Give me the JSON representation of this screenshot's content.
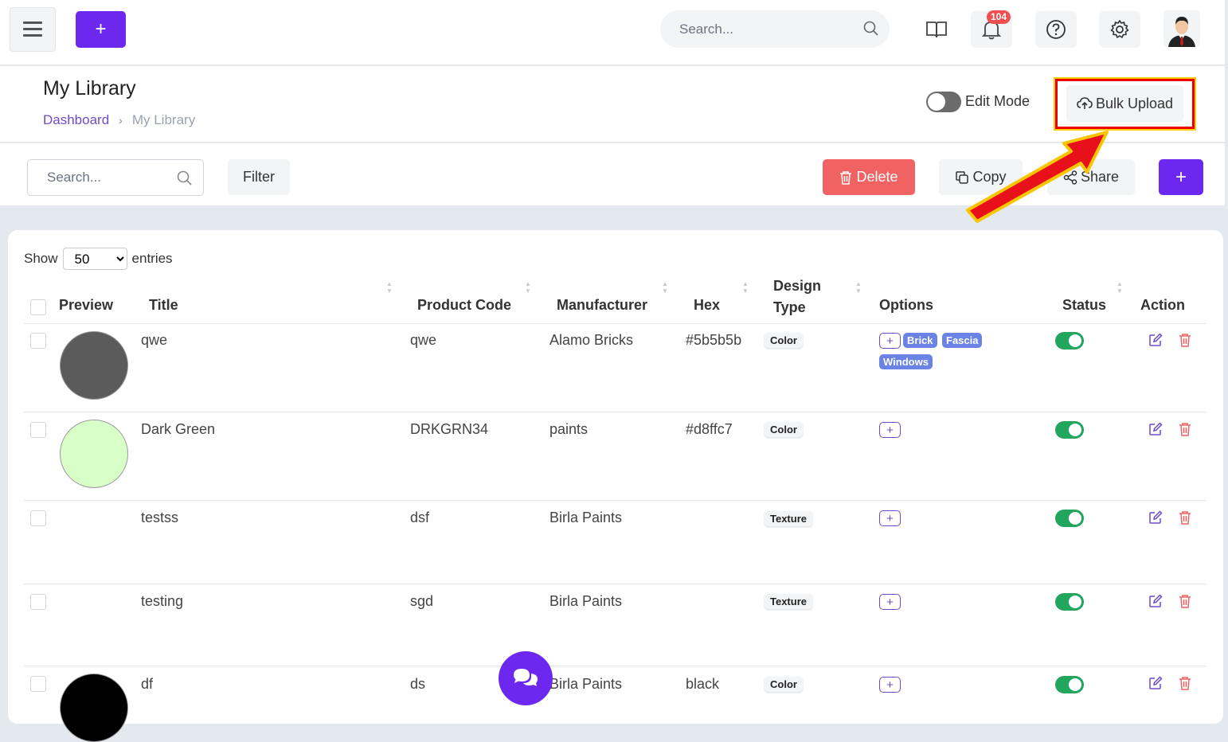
{
  "topbar": {
    "search_placeholder": "Search...",
    "notification_count": "104",
    "icons": [
      "menu-icon",
      "plus-icon",
      "search-icon",
      "book-icon",
      "bell-icon",
      "help-icon",
      "gear-icon",
      "avatar"
    ]
  },
  "header": {
    "title": "My Library",
    "breadcrumb": [
      "Dashboard",
      "My Library"
    ],
    "edit_mode_label": "Edit Mode",
    "bulk_upload_label": "Bulk Upload"
  },
  "toolbar": {
    "search_placeholder": "Search...",
    "filter_label": "Filter",
    "delete_label": "Delete",
    "copy_label": "Copy",
    "share_label": "Share",
    "add_label": "+"
  },
  "table": {
    "show_label": "Show",
    "entries_value": "50",
    "entries_label": "entries",
    "headers": {
      "preview": "Preview",
      "title": "Title",
      "product_code": "Product Code",
      "manufacturer": "Manufacturer",
      "hex": "Hex",
      "design": "Design",
      "type": "Type",
      "options": "Options",
      "status": "Status",
      "action": "Action"
    },
    "rows": [
      {
        "title": "qwe",
        "code": "qwe",
        "manufacturer": "Alamo Bricks",
        "hex": "#5b5b5b",
        "type": "Color",
        "swatch": "#5b5b5b",
        "tags": [
          "Brick",
          "Fascia",
          "Windows"
        ]
      },
      {
        "title": "Dark Green",
        "code": "DRKGRN34",
        "manufacturer": "paints",
        "hex": "#d8ffc7",
        "type": "Color",
        "swatch": "#d8ffc7",
        "tags": []
      },
      {
        "title": "testss",
        "code": "dsf",
        "manufacturer": "Birla Paints",
        "hex": "",
        "type": "Texture",
        "swatch": "",
        "tags": []
      },
      {
        "title": "testing",
        "code": "sgd",
        "manufacturer": "Birla Paints",
        "hex": "",
        "type": "Texture",
        "swatch": "",
        "tags": []
      },
      {
        "title": "df",
        "code": "ds",
        "manufacturer": "Birla Paints",
        "hex": "black",
        "type": "Color",
        "swatch": "#000000",
        "tags": []
      }
    ]
  },
  "colors": {
    "accent": "#6d28f0",
    "delete": "#f16363",
    "status_on": "#22a55d",
    "tag": "#6b82e6"
  }
}
